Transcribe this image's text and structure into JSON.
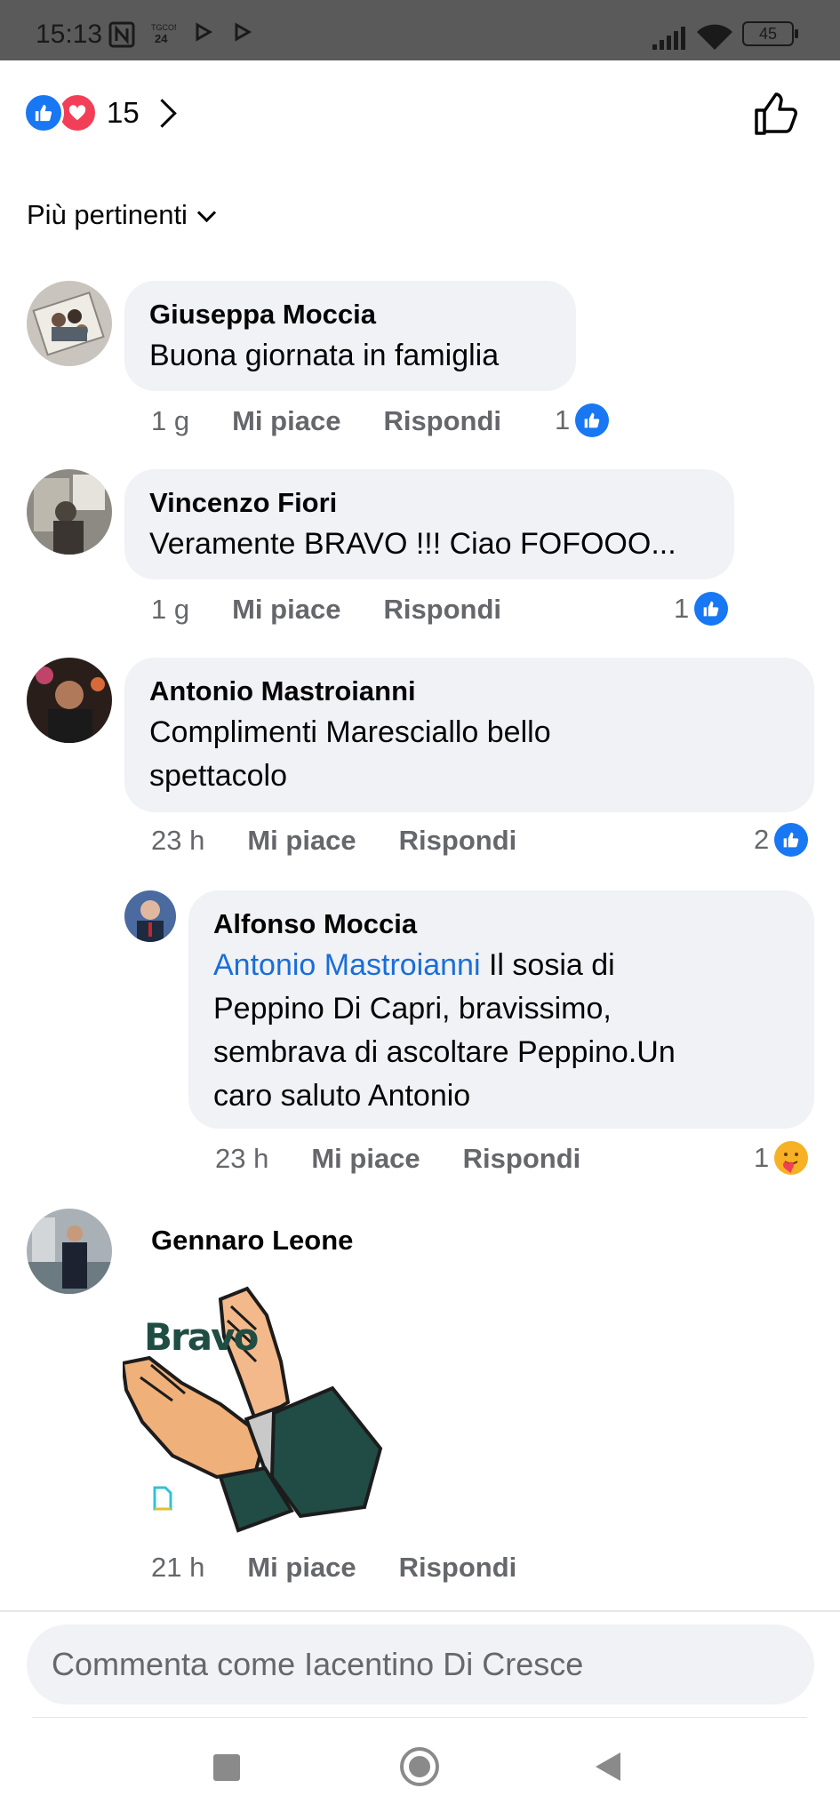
{
  "status_bar": {
    "time": "15:13",
    "battery": "45"
  },
  "reactions_summary": {
    "count": "15"
  },
  "sort": {
    "label": "Più pertinenti"
  },
  "comments": [
    {
      "author": "Giuseppa Moccia",
      "text": "Buona giornata in famiglia",
      "time": "1 g",
      "like_label": "Mi piace",
      "reply_label": "Rispondi",
      "reaction_count": "1",
      "reaction_type": "like"
    },
    {
      "author": "Vincenzo Fiori",
      "text": "Veramente BRAVO !!! Ciao FOFOOO...",
      "time": "1 g",
      "like_label": "Mi piace",
      "reply_label": "Rispondi",
      "reaction_count": "1",
      "reaction_type": "like"
    },
    {
      "author": "Antonio Mastroianni",
      "text_line1": "Complimenti Maresciallo  bello",
      "text_line2": "spettacolo",
      "time": "23 h",
      "like_label": "Mi piace",
      "reply_label": "Rispondi",
      "reaction_count": "2",
      "reaction_type": "like"
    },
    {
      "author": "Alfonso Moccia",
      "mention": "Antonio Mastroianni",
      "text_line1": " Il sosia di",
      "text_line2": "Peppino Di Capri, bravissimo,",
      "text_line3": "sembrava di ascoltare Peppino.Un",
      "text_line4": "caro saluto Antonio",
      "time": "23 h",
      "like_label": "Mi piace",
      "reply_label": "Rispondi",
      "reaction_count": "1",
      "reaction_type": "care"
    },
    {
      "author": "Gennaro Leone",
      "sticker_text": "Bravo",
      "time": "21 h",
      "like_label": "Mi piace",
      "reply_label": "Rispondi"
    }
  ],
  "composer": {
    "placeholder": "Commenta come Iacentino Di Cresce"
  },
  "colors": {
    "accent": "#1877f2",
    "bubble": "#f0f2f5",
    "mention": "#1a6ed8",
    "meta": "#65676b"
  }
}
